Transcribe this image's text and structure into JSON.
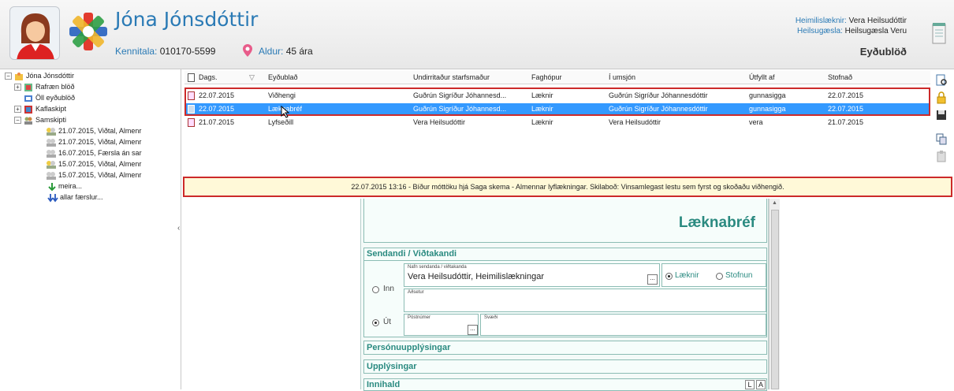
{
  "header": {
    "patient_name": "Jóna Jónsdóttir",
    "kennitala_label": "Kennitala:",
    "kennitala_value": "010170-5599",
    "aldur_label": "Aldur:",
    "aldur_value": "45 ára",
    "heimilislaeknir_label": "Heimilislæknir:",
    "heimilislaeknir_value": "Vera Heilsudóttir",
    "heilsugaesla_label": "Heilsugæsla:",
    "heilsugaesla_value": "Heilsugæsla Veru",
    "section_title": "Eyðublöð"
  },
  "tree": {
    "root": "Jóna Jónsdóttir",
    "items": [
      "Rafræn blöð",
      "Öll eyðublöð",
      "Kaflaskipt",
      "Samskipti"
    ],
    "samskipti_children": [
      "21.07.2015, Viðtal, Almenr",
      "21.07.2015, Viðtal, Almenr",
      "16.07.2015, Færsla án sar",
      "15.07.2015, Viðtal, Almenr",
      "15.07.2015, Viðtal, Almenr",
      "meira...",
      "allar færslur..."
    ]
  },
  "grid": {
    "columns": [
      "Dags.",
      "Eyðublað",
      "Undirritaður starfsmaður",
      "Faghópur",
      "Í umsjón",
      "Útfyllt af",
      "Stofnað"
    ],
    "rows": [
      [
        "22.07.2015",
        "Viðhengi",
        "Guðrún Sigríður Jóhannesd...",
        "Læknir",
        "Guðrún Sigríður Jóhannesdóttir",
        "gunnasigga",
        "22.07.2015"
      ],
      [
        "22.07.2015",
        "Læknabréf",
        "Guðrún Sigríður Jóhannesd...",
        "Læknir",
        "Guðrún Sigríður Jóhannesdóttir",
        "gunnasigga",
        "22.07.2015"
      ],
      [
        "21.07.2015",
        "Lyfseðill",
        "Vera Heilsudóttir",
        "Læknir",
        "Vera Heilsudóttir",
        "vera",
        "21.07.2015"
      ]
    ],
    "selected_row": 1
  },
  "banner": "22.07.2015 13:16 - Bíður móttöku hjá Saga skema - Almennar lyflækningar. Skilaboð: Vinsamlegast lestu sem fyrst og skoðaðu viðhengið.",
  "form": {
    "title": "Læknabréf",
    "sendandi_header": "Sendandi / Viðtakandi",
    "nafn_label": "Nafn sendanda / viðtakanda",
    "nafn_value": "Vera Heilsudóttir, Heimilislækningar",
    "dots": "...",
    "opt_laeknir": "Læknir",
    "opt_stofnun": "Stofnun",
    "opt_inn": "Inn",
    "opt_ut": "Út",
    "heimilisfang_label": "Aðsetur",
    "postnumer_label": "Póstnúmer",
    "svaedi_label": "Svæði",
    "sections": [
      "Persónuupplýsingar",
      "Upplýsingar",
      "Innihald"
    ],
    "btn_l": "L",
    "btn_a": "A"
  },
  "colors": {
    "accent": "#2a7ab5",
    "form_accent": "#2a8a80",
    "selection": "#3399ff",
    "highlight": "#cc2a2a",
    "banner_bg": "#fff9d8"
  }
}
